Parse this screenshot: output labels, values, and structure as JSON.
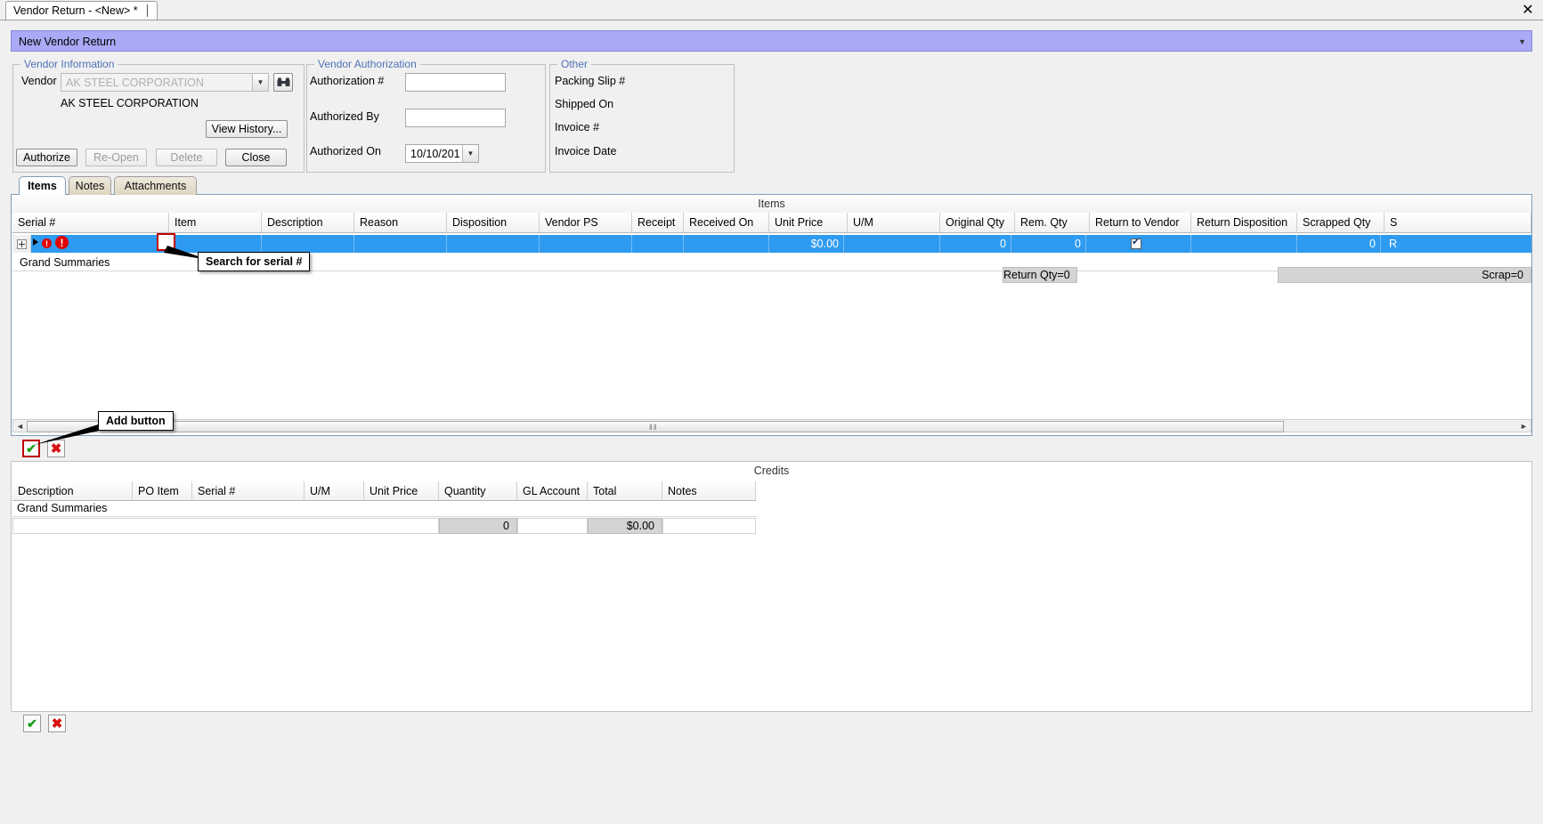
{
  "window": {
    "tab_title": "Vendor Return - <New> *",
    "close_label": "✕"
  },
  "title_bar": {
    "text": "New Vendor Return",
    "collapse_icon": "▼"
  },
  "vendor_information": {
    "legend": "Vendor Information",
    "vendor_label": "Vendor",
    "vendor_value": "AK STEEL CORPORATION",
    "vendor_name_display": "AK STEEL CORPORATION",
    "dropdown_icon": "▼",
    "binoculars_icon": "⚇⚇",
    "view_history_label": "View History...",
    "buttons": [
      {
        "label": "Authorize",
        "enabled": true
      },
      {
        "label": "Re-Open",
        "enabled": false
      },
      {
        "label": "Delete",
        "enabled": false
      },
      {
        "label": "Close",
        "enabled": true
      }
    ]
  },
  "vendor_authorization": {
    "legend": "Vendor Authorization",
    "authorization_number_label": "Authorization #",
    "authorization_number_value": "",
    "authorized_by_label": "Authorized By",
    "authorized_by_value": "",
    "authorized_on_label": "Authorized On",
    "authorized_on_value": "10/10/201",
    "date_dropdown_icon": "▼"
  },
  "other": {
    "legend": "Other",
    "packing_slip_label": "Packing Slip #",
    "shipped_on_label": "Shipped On",
    "invoice_number_label": "Invoice #",
    "invoice_date_label": "Invoice Date"
  },
  "tabs": [
    {
      "label": "Items",
      "active": true
    },
    {
      "label": "Notes",
      "active": false
    },
    {
      "label": "Attachments",
      "active": false
    }
  ],
  "items_grid": {
    "caption": "Items",
    "columns": [
      "Serial #",
      "Item",
      "Description",
      "Reason",
      "Disposition",
      "Vendor PS",
      "Receipt",
      "Received On",
      "Unit Price",
      "U/M",
      "Original Qty",
      "Rem. Qty",
      "Return to Vendor",
      "Return Disposition",
      "Scrapped Qty",
      "S"
    ],
    "row": {
      "expand_icon": "+",
      "row_pointer_icon": "▶",
      "error_icon_1": "!",
      "error_icon_2": "!",
      "serial_number": "",
      "item": "",
      "description": "",
      "reason": "",
      "disposition": "",
      "vendor_ps": "",
      "receipt": "",
      "received_on": "",
      "unit_price": "$0.00",
      "um": "",
      "original_qty": "0",
      "rem_qty": "0",
      "return_to_vendor_checked": true,
      "return_disposition": "",
      "scrapped_qty": "0",
      "scrapped_extra": "R"
    },
    "grand_summaries_label": "Grand Summaries",
    "summary_return_qty": "Return Qty=0",
    "summary_scrap": "Scrap=0",
    "scroll_left_icon": "◄",
    "scroll_right_icon": "►",
    "gripper_icon": "‖‖"
  },
  "items_toolbar": {
    "add_icon": "✔",
    "delete_icon": "✖"
  },
  "credits_grid": {
    "caption": "Credits",
    "columns": [
      "Description",
      "PO Item",
      "Serial #",
      "U/M",
      "Unit Price",
      "Quantity",
      "GL Account",
      "Total",
      "Notes"
    ],
    "grand_summaries_label": "Grand Summaries",
    "summary_quantity": "0",
    "summary_total": "$0.00"
  },
  "credits_toolbar": {
    "add_icon": "✔",
    "delete_icon": "✖"
  },
  "annotations": [
    {
      "text": "Search for serial #"
    },
    {
      "text": "Add button"
    }
  ],
  "colors": {
    "title_bar": "#a9a9f5",
    "selection": "#2e9bf0",
    "legend_text": "#4f72b8",
    "highlight_border": "#c00000",
    "error": "#e00000"
  }
}
